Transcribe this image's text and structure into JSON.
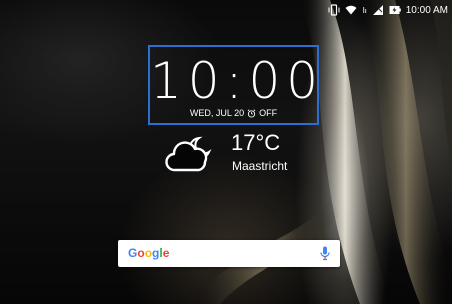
{
  "status_bar": {
    "time": "10:00 AM",
    "icons": [
      "vibrate-icon",
      "wifi-icon",
      "signal-icon",
      "no-sim-icon",
      "battery-charging-icon"
    ]
  },
  "clock": {
    "time": "10:00",
    "date": "WED, JUL 20",
    "alarm_status": "OFF",
    "accent_color": "#2c6fd1"
  },
  "weather": {
    "temperature": "17°C",
    "city": "Maastricht",
    "icon": "cloud-night-icon"
  },
  "search": {
    "logo": [
      "G",
      "o",
      "o",
      "g",
      "l",
      "e"
    ],
    "logo_colors": [
      "#4285F4",
      "#EA4335",
      "#FBBC05",
      "#4285F4",
      "#34A853",
      "#EA4335"
    ],
    "mic_icon": "mic-icon"
  }
}
